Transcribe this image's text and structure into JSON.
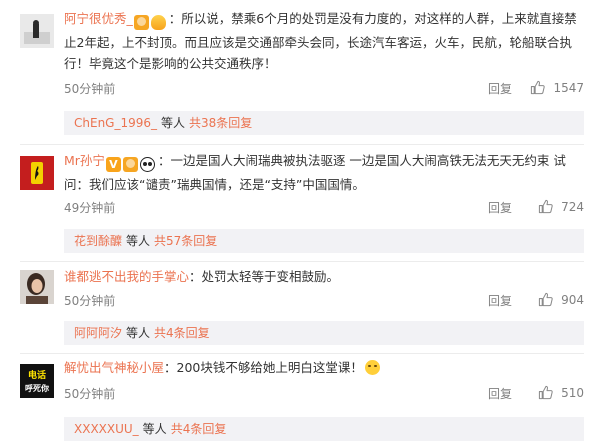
{
  "comments": [
    {
      "username": "阿宁很优秀_",
      "text": "：所以说，禁乘6个月的处罚是没有力度的，对这样的人群，上来就直接禁止2年起，上不封顶。而且应该是交通部牵头会同，长途汽车客运，火车，民航，轮船联合执行！毕竟这个是影响的公共交通秩序！",
      "time": "50分钟前",
      "reply_label": "回复",
      "likes": "1547",
      "sub_user": "ChEnG_1996_",
      "sub_mid": "等人",
      "sub_count": "共38条回复"
    },
    {
      "username": "Mr孙宁",
      "text": "：一边是国人大闹瑞典被执法驱逐 一边是国人大闹高铁无法无天无约束 试问：我们应该“谴责”瑞典国情，还是“支持”中国国情。",
      "time": "49分钟前",
      "reply_label": "回复",
      "likes": "724",
      "sub_user": "花到酴醾",
      "sub_mid": "等人",
      "sub_count": "共57条回复"
    },
    {
      "username": "谁都逃不出我的手掌心",
      "text": "：处罚太轻等于变相鼓励。",
      "time": "50分钟前",
      "reply_label": "回复",
      "likes": "904",
      "sub_user": "阿阿阿汐",
      "sub_mid": "等人",
      "sub_count": "共4条回复"
    },
    {
      "username": "解忧出气神秘小屋",
      "text": "：200块钱不够给她上明白这堂课！",
      "time": "50分钟前",
      "reply_label": "回复",
      "likes": "510",
      "sub_user": "XXXXXUU_",
      "sub_mid": "等人",
      "sub_count": "共4条回复"
    }
  ],
  "avatar4_text": [
    "电话",
    "呼死你"
  ],
  "colors": {
    "username": "#eb7350",
    "meta": "#808080",
    "sub_box": "#f2f2f5",
    "badge_gold": "#f6a623"
  },
  "icons": {
    "like": "thumbs-up-icon",
    "vip": "vip-badge-icon",
    "verified": "verified-v-icon",
    "panda": "panda-icon",
    "bulb": "lightbulb-icon",
    "emoji": "sweat-smile-emoji-icon"
  }
}
